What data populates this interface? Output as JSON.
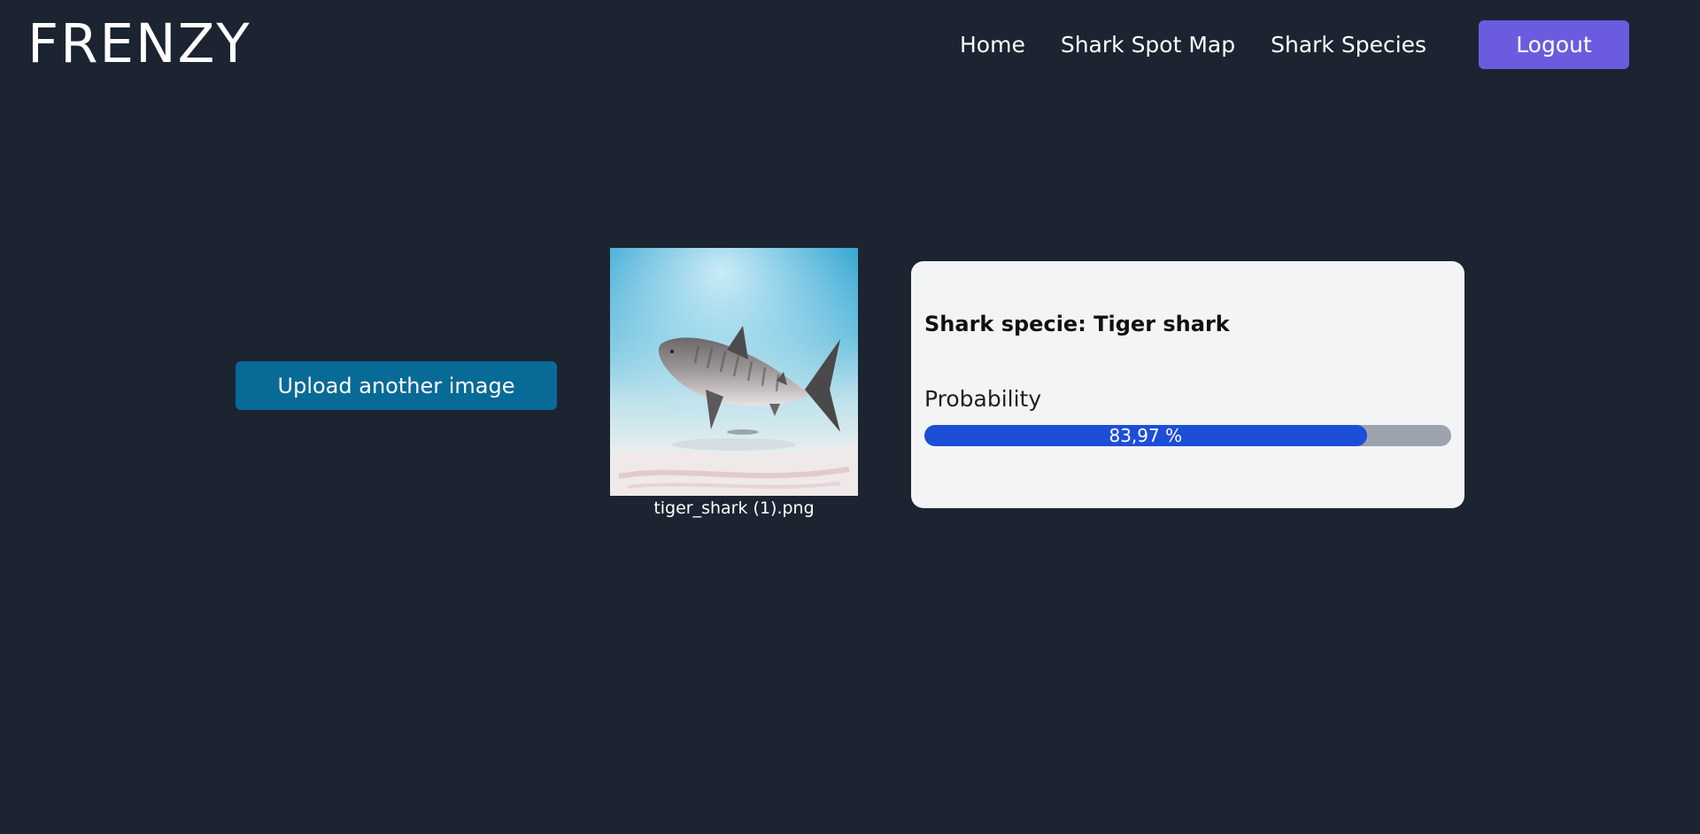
{
  "header": {
    "logo": "FRENZY",
    "nav": [
      {
        "label": "Home"
      },
      {
        "label": "Shark Spot Map"
      },
      {
        "label": "Shark Species"
      }
    ],
    "logout_label": "Logout",
    "logout_color": "#6b5cdf"
  },
  "main": {
    "upload_label": "Upload another image",
    "upload_color": "#086a96",
    "image": {
      "filename": "tiger_shark (1).png",
      "subject": "tiger shark swimming over sandy seabed"
    },
    "result": {
      "species_text": "Shark specie: Tiger shark",
      "probability_label": "Probability",
      "probability_value": 83.97,
      "probability_text": "83,97 %",
      "fill_color": "#1d4ed8",
      "track_color": "#9ca3af"
    }
  },
  "colors": {
    "background": "#1c2431",
    "card": "#f3f4f6"
  }
}
